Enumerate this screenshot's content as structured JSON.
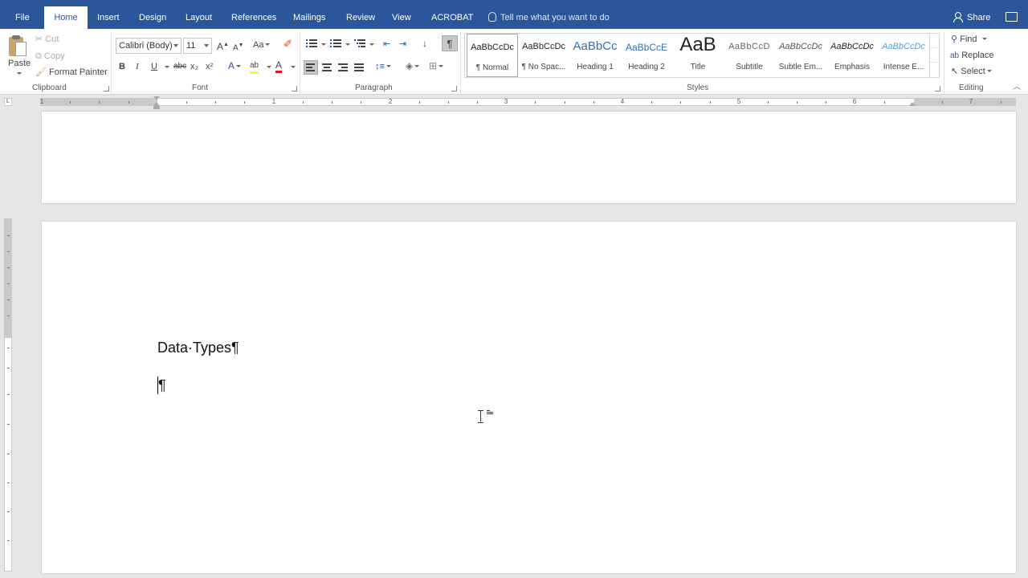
{
  "tabs": [
    {
      "label": "File"
    },
    {
      "label": "Home"
    },
    {
      "label": "Insert"
    },
    {
      "label": "Design"
    },
    {
      "label": "Layout"
    },
    {
      "label": "References"
    },
    {
      "label": "Mailings"
    },
    {
      "label": "Review"
    },
    {
      "label": "View"
    },
    {
      "label": "ACROBAT"
    }
  ],
  "active_tab": "Home",
  "tell_me": "Tell me what you want to do",
  "share": "Share",
  "clipboard": {
    "paste": "Paste",
    "cut": "Cut",
    "copy": "Copy",
    "format_painter": "Format Painter",
    "label": "Clipboard"
  },
  "font": {
    "family": "Calibri (Body)",
    "size": "11",
    "change_case": "Aa",
    "bold": "B",
    "italic": "I",
    "underline": "U",
    "strikethrough": "abc",
    "subscript": "x₂",
    "superscript": "x²",
    "grow": "A",
    "shrink": "A",
    "text_effects": "A",
    "highlight": "ab",
    "font_color": "A",
    "font_color_hex": "#e81123",
    "highlight_hex": "#ffff00",
    "label": "Font"
  },
  "paragraph": {
    "show_hide": "¶",
    "sort": "↓",
    "label": "Paragraph"
  },
  "styles": {
    "items": [
      {
        "sample": "AaBbCcDc",
        "name": "¶ Normal"
      },
      {
        "sample": "AaBbCcDc",
        "name": "¶ No Spac..."
      },
      {
        "sample": "AaBbCc",
        "name": "Heading 1"
      },
      {
        "sample": "AaBbCcE",
        "name": "Heading 2"
      },
      {
        "sample": "AaB",
        "name": "Title"
      },
      {
        "sample": "AaBbCcD",
        "name": "Subtitle"
      },
      {
        "sample": "AaBbCcDc",
        "name": "Subtle Em..."
      },
      {
        "sample": "AaBbCcDc",
        "name": "Emphasis"
      },
      {
        "sample": "AaBbCcDc",
        "name": "Intense E..."
      }
    ],
    "label": "Styles"
  },
  "editing": {
    "find": "Find",
    "replace": "Replace",
    "select": "Select",
    "label": "Editing"
  },
  "ruler": {
    "numbers": [
      "1",
      "1",
      "2",
      "3",
      "4",
      "5",
      "6",
      "7"
    ],
    "tab_selector": "L"
  },
  "document": {
    "line1": "Data·Types¶",
    "line2": "¶"
  },
  "colors": {
    "accent": "#2b579a",
    "heading_blue": "#2e74b5",
    "background": "#e6e6e6"
  }
}
